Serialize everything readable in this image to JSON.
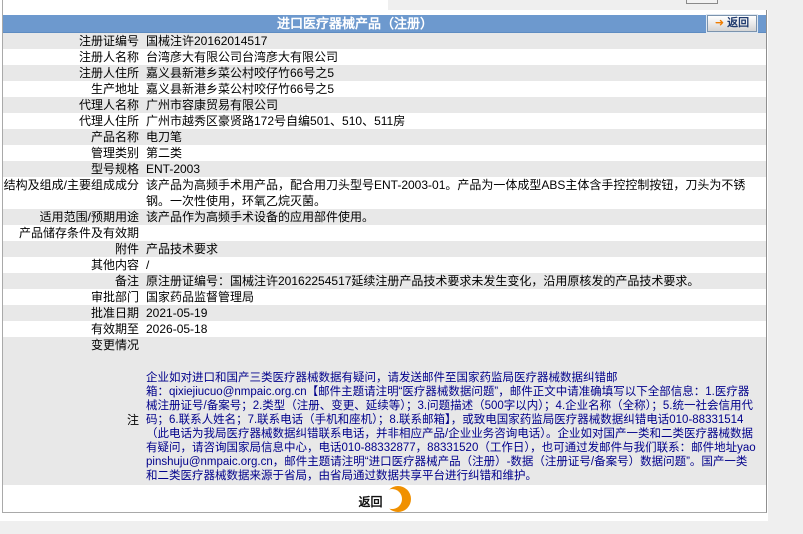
{
  "page": {
    "header": {
      "title": "进口医疗器械产品（注册）",
      "back_label": "返回",
      "back_arrow": "➜"
    },
    "rows": [
      {
        "label": "注册证编号",
        "value": "国械注许20162014517"
      },
      {
        "label": "注册人名称",
        "value": "台湾彦大有限公司台湾彦大有限公司"
      },
      {
        "label": "注册人住所",
        "value": "嘉义县新港乡菜公村咬仔竹66号之5"
      },
      {
        "label": "生产地址",
        "value": "嘉义县新港乡菜公村咬仔竹66号之5"
      },
      {
        "label": "代理人名称",
        "value": "广州市容康贸易有限公司"
      },
      {
        "label": "代理人住所",
        "value": "广州市越秀区豪贤路172号自编501、510、511房"
      },
      {
        "label": "产品名称",
        "value": "电刀笔"
      },
      {
        "label": "管理类别",
        "value": "第二类"
      },
      {
        "label": "型号规格",
        "value": "ENT-2003"
      },
      {
        "label": "结构及组成/主要组成成分",
        "value": "该产品为高频手术用产品，配合用刀头型号ENT-2003-01。产品为一体成型ABS主体含手控控制按钮，刀头为不锈钢。一次性使用，环氧乙烷灭菌。"
      },
      {
        "label": "适用范围/预期用途",
        "value": "该产品作为高频手术设备的应用部件使用。"
      },
      {
        "label": "产品储存条件及有效期",
        "value": ""
      },
      {
        "label": "附件",
        "value": "产品技术要求"
      },
      {
        "label": "其他内容",
        "value": "/"
      },
      {
        "label": "备注",
        "value": "原注册证编号：国械注许20162254517延续注册产品技术要求未发生变化，沿用原核发的产品技术要求。"
      },
      {
        "label": "审批部门",
        "value": "国家药品监督管理局"
      },
      {
        "label": "批准日期",
        "value": "2021-05-19"
      },
      {
        "label": "有效期至",
        "value": "2026-05-18"
      },
      {
        "label": "变更情况",
        "value": ""
      }
    ],
    "note": {
      "label": "注",
      "text": "企业如对进口和国产三类医疗器械数据有疑问，请发送邮件至国家药监局医疗器械数据纠错邮\n箱：qixiejiucuo@nmpaic.org.cn【邮件主题请注明“医疗器械数据问题”，邮件正文中请准确填写以下全部信息：1.医疗器械注册证号/备案号；2.类型（注册、变更、延续等）；3.问题描述（500字以内）；4.企业名称（全称）；5.统一社会信用代码；6.联系人姓名；7.联系电话（手机和座机）；8.联系邮箱】，或致电国家药监局医疗器械数据纠错电话010-88331514（此电话为我局医疗器械数据纠错联系电话，并非相应产品/企业业务咨询电话）。企业如对国产一类和二类医疗器械数据有疑问，请咨询国家局信息中心，电话010-88332877，88331520（工作日），也可通过发邮件与我们联系：邮件地址yaopinshuju@nmpaic.org.cn，邮件主题请注明“进口医疗器械产品（注册）-数据（注册证号/备案号）数据问题”。国产一类和二类医疗器械数据来源于省局，由省局通过数据共享平台进行纠错和维护。"
    },
    "footer": {
      "return_label": "返回"
    },
    "colors": {
      "header_blue": "#6d99ce",
      "row_alt_gray": "#e8e8e8",
      "note_text_navy": "#00008b",
      "accent_orange": "#f09000"
    }
  }
}
